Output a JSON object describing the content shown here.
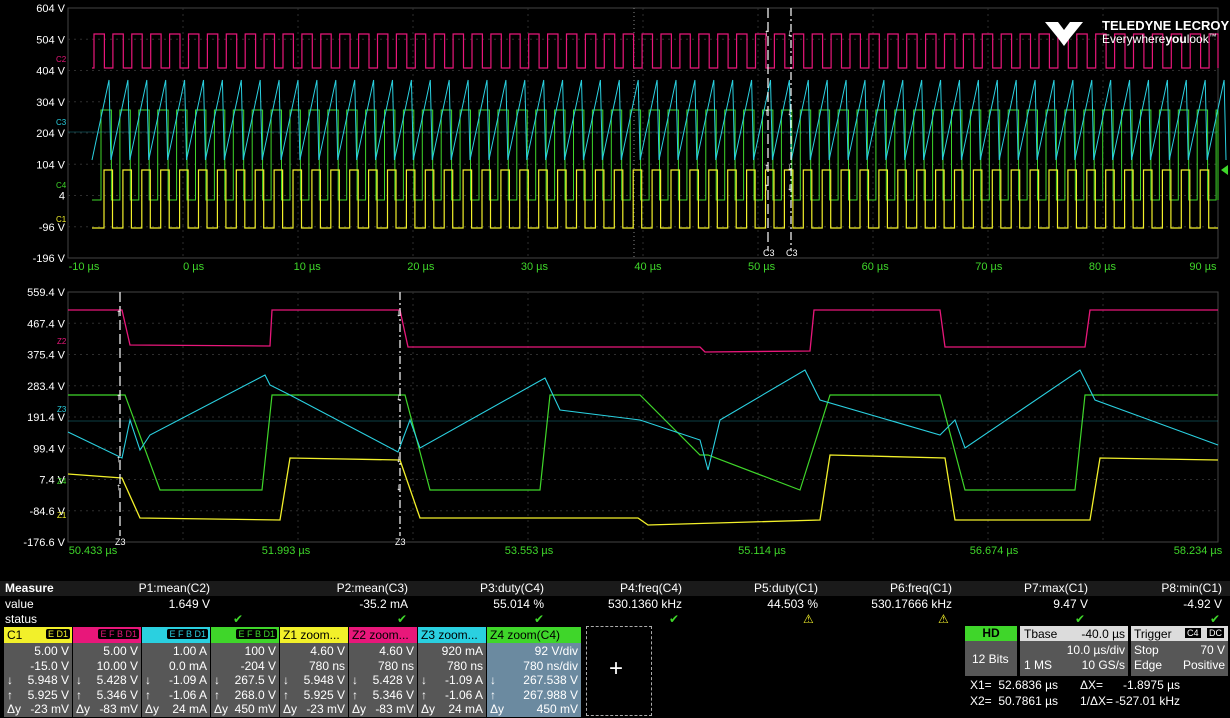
{
  "brand": {
    "name": "TELEDYNE LECROY",
    "tagline_a": "Everywhere",
    "tagline_b": "you",
    "tagline_c": "look",
    "tm": "™"
  },
  "top_grid": {
    "y_labels": [
      "604 V",
      "504 V",
      "404 V",
      "304 V",
      "204 V",
      "104 V",
      "4",
      "-96 V",
      "-196 V"
    ],
    "x_labels": [
      "-10 µs",
      "0 µs",
      "10 µs",
      "20 µs",
      "30 µs",
      "40 µs",
      "50 µs",
      "60 µs",
      "70 µs",
      "80 µs",
      "90 µs"
    ],
    "cursor_labels": [
      "C3",
      "C3"
    ],
    "trace_labels": [
      "C2",
      "C3",
      "C4",
      "C1"
    ]
  },
  "bottom_grid": {
    "y_labels": [
      "559.4 V",
      "467.4 V",
      "375.4 V",
      "283.4 V",
      "191.4 V",
      "99.4 V",
      "7.4 V",
      "-84.6 V",
      "-176.6 V"
    ],
    "x_labels": [
      "50.433 µs",
      "51.993 µs",
      "53.553 µs",
      "55.114 µs",
      "56.674 µs",
      "58.234 µs"
    ],
    "cursor_labels": [
      "Z3",
      "Z3"
    ],
    "trace_labels": [
      "Z2",
      "Z3",
      "Z4",
      "Z1"
    ]
  },
  "colors": {
    "c1": "#f2f02a",
    "c2": "#e8177a",
    "c3": "#2ad0e0",
    "c4": "#3fd62a",
    "grid": "#2e2e2e",
    "white": "#ffffff",
    "gray": "#575757"
  },
  "measure": {
    "header_label": "Measure",
    "value_label": "value",
    "status_label": "status",
    "params": [
      {
        "name": "P1:mean(C2)",
        "value": "1.649 V",
        "status": "ok"
      },
      {
        "name": "P2:mean(C3)",
        "value": "-35.2 mA",
        "status": "ok"
      },
      {
        "name": "P3:duty(C4)",
        "value": "55.014 %",
        "status": "ok"
      },
      {
        "name": "P4:freq(C4)",
        "value": "530.1360 kHz",
        "status": "ok"
      },
      {
        "name": "P5:duty(C1)",
        "value": "44.503 %",
        "status": "warn"
      },
      {
        "name": "P6:freq(C1)",
        "value": "530.17666 kHz",
        "status": "warn"
      },
      {
        "name": "P7:max(C1)",
        "value": "9.47 V",
        "status": "ok"
      },
      {
        "name": "P8:min(C1)",
        "value": "-4.92 V",
        "status": "ok"
      }
    ]
  },
  "channels": [
    {
      "name": "C1",
      "tag": "E D1",
      "rows": [
        "5.00 V",
        "-15.0 V",
        "5.948 V",
        "5.925 V",
        "-23 mV"
      ]
    },
    {
      "name": "",
      "tag": "E F B D1",
      "rows": [
        "5.00 V",
        "10.00 V",
        "5.428 V",
        "5.346 V",
        "-83 mV"
      ]
    },
    {
      "name": "",
      "tag": "E F B D1",
      "rows": [
        "1.00 A",
        "0.0 mA",
        "-1.09 A",
        "-1.06 A",
        "24 mA"
      ]
    },
    {
      "name": "",
      "tag": "E F B D1",
      "rows": [
        "100 V",
        "-204 V",
        "267.5 V",
        "268.0 V",
        "450 mV"
      ]
    },
    {
      "name": "Z1 zoom...",
      "tag": "",
      "rows": [
        "4.60 V",
        "780 ns",
        "5.948 V",
        "5.925 V",
        "-23 mV"
      ]
    },
    {
      "name": "Z2 zoom...",
      "tag": "",
      "rows": [
        "4.60 V",
        "780 ns",
        "5.428 V",
        "5.346 V",
        "-83 mV"
      ]
    },
    {
      "name": "Z3 zoom...",
      "tag": "",
      "rows": [
        "920 mA",
        "780 ns",
        "-1.09 A",
        "-1.06 A",
        "24 mA"
      ]
    },
    {
      "name": "Z4     zoom(C4)",
      "tag": "",
      "rows": [
        "92 V/div",
        "780 ns/div",
        "267.538 V",
        "267.988 V",
        "450 mV"
      ]
    }
  ],
  "add_button": "+",
  "acq": {
    "hd": "HD",
    "bits": "12 Bits",
    "tbase_label": "Tbase",
    "tbase_value": "-40.0 µs",
    "tdiv": "10.0 µs/div",
    "mem": "1 MS",
    "rate": "10 GS/s",
    "trigger_label": "Trigger",
    "trigger_ch": "C4",
    "trigger_cpl": "DC",
    "trig_mode": "Stop",
    "trig_level": "70 V",
    "trig_type": "Edge",
    "trig_slope": "Positive"
  },
  "cursors": {
    "x1_label": "X1=",
    "x1_value": "52.6836 µs",
    "dx_label": "ΔX=",
    "dx_value": "-1.8975 µs",
    "x2_label": "X2=",
    "x2_value": "50.7861 µs",
    "inv_label": "1/ΔX=",
    "inv_value": "-527.01 kHz"
  },
  "row_labels": [
    "",
    "",
    "↓",
    "↑",
    "Δy"
  ]
}
